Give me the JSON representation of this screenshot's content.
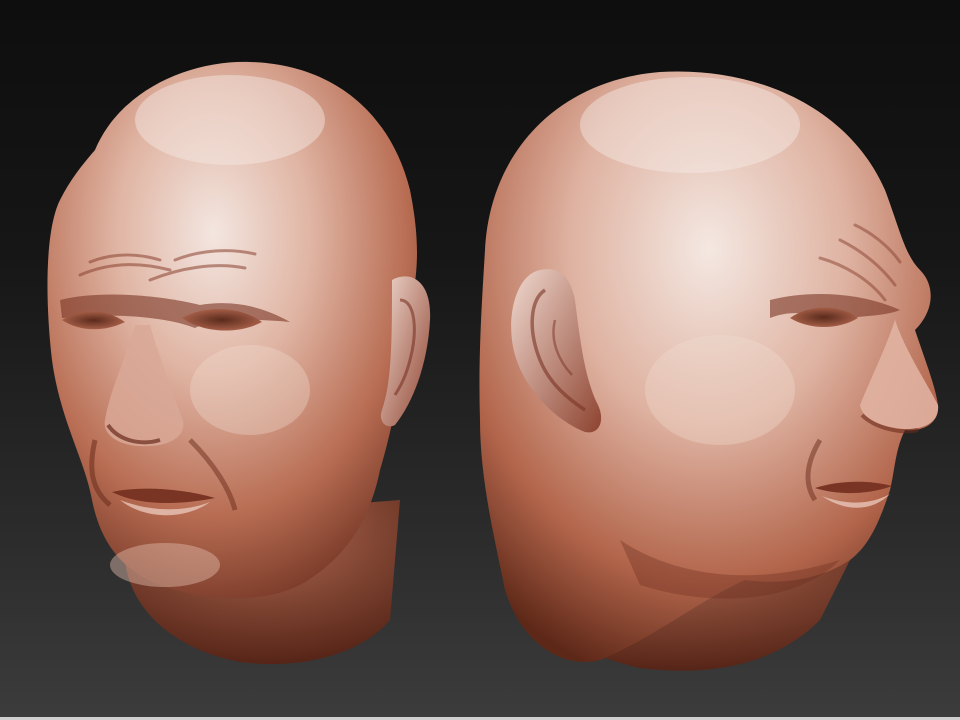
{
  "scene": {
    "background_top": "#0e0e0e",
    "background_bottom": "#3c3c3c",
    "skin_highlight": "#f1e2dc",
    "skin_mid": "#c98a73",
    "skin_shadow": "#7a3a28",
    "skin_deep": "#4a1d12"
  },
  "models": [
    {
      "kind": "sculpted-head",
      "view": "three-quarter-front"
    },
    {
      "kind": "sculpted-head",
      "view": "three-quarter-profile"
    }
  ]
}
